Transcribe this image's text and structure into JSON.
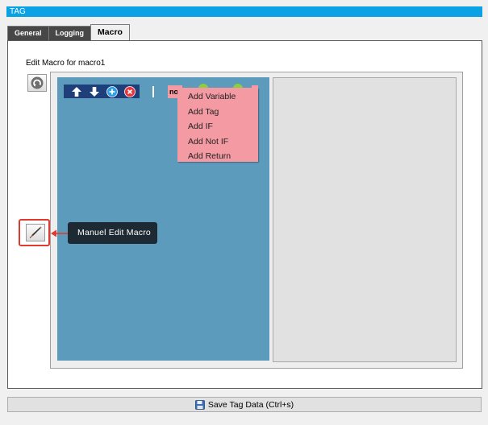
{
  "window": {
    "title": "TAG"
  },
  "tabs": [
    {
      "label": "General",
      "active": false
    },
    {
      "label": "Logging",
      "active": false
    },
    {
      "label": "Macro",
      "active": true
    }
  ],
  "editor": {
    "heading": "Edit Macro for macro1",
    "undo_icon": "undo-icon",
    "manual_edit_icon": "pen-icon",
    "tooltip": "Manuel Edit Macro"
  },
  "mini_toolbar": {
    "icons": [
      "arrow-up-icon",
      "arrow-down-icon",
      "plus-circle-icon",
      "close-circle-icon"
    ]
  },
  "node": {
    "chip_text": "no"
  },
  "context_menu": {
    "items": [
      "Add Variable",
      "Add Tag",
      "Add IF",
      "Add Not IF",
      "Add Return"
    ]
  },
  "footer": {
    "save_label": "Save Tag Data (Ctrl+s)",
    "save_icon": "floppy-disk-icon"
  },
  "colors": {
    "title_bar": "#0aa2e4",
    "tab_inactive": "#474747",
    "canvas_blue": "#5d9bbc",
    "menu_pink": "#f49aa3",
    "highlight_red": "#e03a2f",
    "tooltip_bg": "#1e2a33",
    "toolbar_navy": "#1f3f7a"
  }
}
